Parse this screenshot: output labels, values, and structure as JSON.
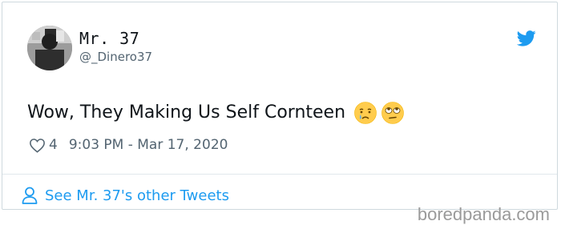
{
  "tweet": {
    "display_name": "Mr. 37",
    "handle": "@_Dinero37",
    "text": "Wow, They Making Us Self Cornteen",
    "emojis": [
      "crying-face-emoji",
      "eye-roll-emoji"
    ],
    "like_count": "4",
    "timestamp": "9:03 PM - Mar 17, 2020"
  },
  "footer": {
    "link_text": "See Mr. 37's other Tweets"
  },
  "watermark": {
    "text": "boredpanda.com"
  },
  "colors": {
    "twitter_blue": "#1d9bf0",
    "text_primary": "#0f1419",
    "text_secondary": "#536471",
    "border": "#cfd9de"
  },
  "icons": {
    "brand": "twitter-bird-icon",
    "like": "heart-icon",
    "profile": "person-icon"
  }
}
